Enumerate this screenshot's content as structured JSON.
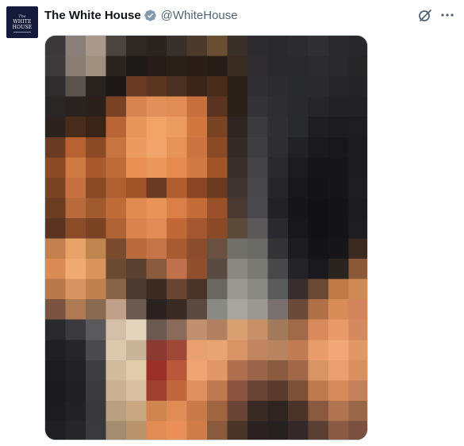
{
  "author": {
    "display_name": "The White House",
    "handle": "@WhiteHouse",
    "verified_badge_icon": "gray-checkmark-badge",
    "verified_badge_color": "#829aab",
    "avatar_lines": [
      "The",
      "WHITE",
      "HOUSE"
    ]
  },
  "actions": {
    "grok_icon": "grok-icon",
    "more_icon": "more-dots-icon"
  },
  "media": {
    "type": "image",
    "description_icon": "pixelated-portrait-image"
  },
  "colors": {
    "name_text": "#0f1419",
    "handle_text": "#536471",
    "border": "#cfd9de"
  }
}
